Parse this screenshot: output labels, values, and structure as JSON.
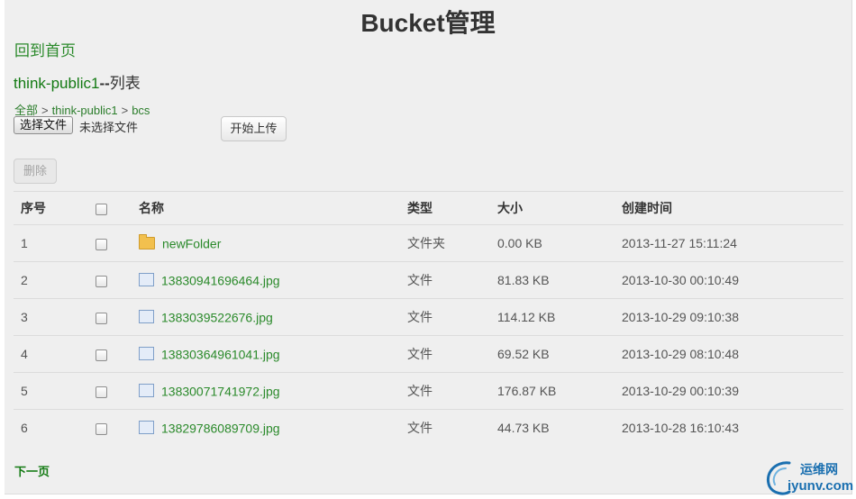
{
  "page": {
    "title": "Bucket管理",
    "home_link": "回到首页",
    "bucket_name": "think-public1",
    "subtitle_sep": "--",
    "subtitle_suffix": "列表"
  },
  "breadcrumb": {
    "items": [
      "全部",
      "think-public1",
      "bcs"
    ],
    "separator": ">"
  },
  "upload": {
    "choose_button": "选择文件",
    "choose_status": "未选择文件",
    "start_button": "开始上传"
  },
  "actions": {
    "delete_button": "删除"
  },
  "table": {
    "headers": [
      "序号",
      "",
      "名称",
      "类型",
      "大小",
      "创建时间"
    ],
    "rows": [
      {
        "index": "1",
        "icon": "folder-icon",
        "name": "newFolder",
        "type": "文件夹",
        "size": "0.00 KB",
        "created": "2013-11-27 15:11:24"
      },
      {
        "index": "2",
        "icon": "file-icon",
        "name": "13830941696464.jpg",
        "type": "文件",
        "size": "81.83 KB",
        "created": "2013-10-30 00:10:49"
      },
      {
        "index": "3",
        "icon": "file-icon",
        "name": "1383039522676.jpg",
        "type": "文件",
        "size": "114.12 KB",
        "created": "2013-10-29 09:10:38"
      },
      {
        "index": "4",
        "icon": "file-icon",
        "name": "13830364961041.jpg",
        "type": "文件",
        "size": "69.52 KB",
        "created": "2013-10-29 08:10:48"
      },
      {
        "index": "5",
        "icon": "file-icon",
        "name": "13830071741972.jpg",
        "type": "文件",
        "size": "176.87 KB",
        "created": "2013-10-29 00:10:39"
      },
      {
        "index": "6",
        "icon": "file-icon",
        "name": "13829786089709.jpg",
        "type": "文件",
        "size": "44.73 KB",
        "created": "2013-10-28 16:10:43"
      }
    ]
  },
  "pagination": {
    "next": "下一页"
  },
  "watermark": {
    "top": "运维网",
    "bottom": "iyunv.com"
  },
  "colors": {
    "link": "#2b8a2b",
    "bucket_name": "#137a13",
    "watermark": "#1a6fb0"
  }
}
